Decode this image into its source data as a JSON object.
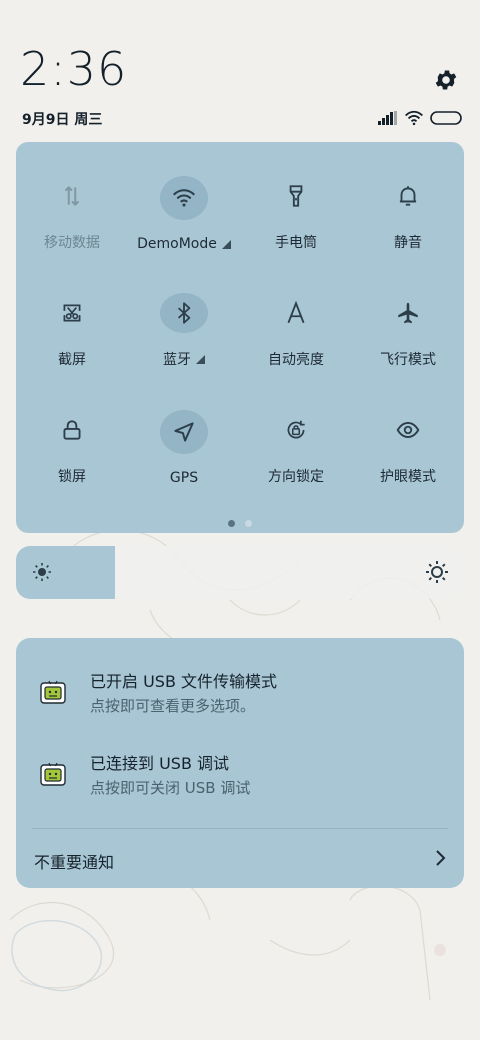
{
  "status": {
    "time": "2:36",
    "date": "9月9日 周三",
    "icons": [
      "signal-icon",
      "wifi-icon",
      "battery-icon"
    ]
  },
  "quick_settings": {
    "tiles": [
      {
        "id": "mobile-data",
        "label": "移动数据",
        "icon": "mobile-data-icon",
        "active": false,
        "disabled": true,
        "has_menu": false
      },
      {
        "id": "wifi",
        "label": "DemoMode",
        "icon": "wifi-icon",
        "active": true,
        "disabled": false,
        "has_menu": true
      },
      {
        "id": "flashlight",
        "label": "手电筒",
        "icon": "flashlight-icon",
        "active": false,
        "disabled": false,
        "has_menu": false
      },
      {
        "id": "mute",
        "label": "静音",
        "icon": "bell-icon",
        "active": false,
        "disabled": false,
        "has_menu": false
      },
      {
        "id": "screenshot",
        "label": "截屏",
        "icon": "screenshot-icon",
        "active": false,
        "disabled": false,
        "has_menu": false
      },
      {
        "id": "bluetooth",
        "label": "蓝牙",
        "icon": "bluetooth-icon",
        "active": true,
        "disabled": false,
        "has_menu": true
      },
      {
        "id": "auto-brightness",
        "label": "自动亮度",
        "icon": "auto-brightness-icon",
        "active": false,
        "disabled": false,
        "has_menu": false
      },
      {
        "id": "airplane",
        "label": "飞行模式",
        "icon": "airplane-icon",
        "active": false,
        "disabled": false,
        "has_menu": false
      },
      {
        "id": "lock-screen",
        "label": "锁屏",
        "icon": "lock-icon",
        "active": false,
        "disabled": false,
        "has_menu": false
      },
      {
        "id": "gps",
        "label": "GPS",
        "icon": "navigation-arrow-icon",
        "active": true,
        "disabled": false,
        "has_menu": false
      },
      {
        "id": "rotation-lock",
        "label": "方向锁定",
        "icon": "rotation-lock-icon",
        "active": false,
        "disabled": false,
        "has_menu": false
      },
      {
        "id": "eye-care",
        "label": "护眼模式",
        "icon": "eye-icon",
        "active": false,
        "disabled": false,
        "has_menu": false
      }
    ],
    "page_count": 2,
    "current_page": 1
  },
  "brightness": {
    "level": 0.22
  },
  "notifications": [
    {
      "title": "已开启 USB 文件传输模式",
      "body": "点按即可查看更多选项。",
      "icon": "android-debug-icon"
    },
    {
      "title": "已连接到 USB 调试",
      "body": "点按即可关闭 USB 调试",
      "icon": "android-debug-icon"
    }
  ],
  "unimportant": {
    "label": "不重要通知"
  },
  "colors": {
    "panel": "#a9c6d5",
    "tile_active": "#93b5c6",
    "icon": "#2c3e49",
    "icon_disabled": "#7f97a4"
  }
}
